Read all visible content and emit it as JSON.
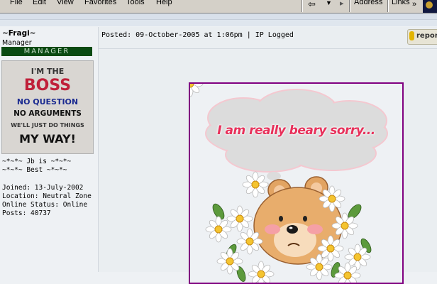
{
  "menu": [
    "File",
    "Edit",
    "View",
    "Favorites",
    "Tools",
    "Help"
  ],
  "toolbar": {
    "address_label": "Address",
    "links_label": "Links"
  },
  "post": {
    "author": {
      "username": "~Fragi~",
      "rank": "Manager",
      "rank_badge": "MANAGER",
      "avatar_text": [
        "I'M THE",
        "BOSS",
        "NO QUESTION",
        "NO ARGUMENTS",
        "WE'LL JUST DO THINGS",
        "MY WAY!"
      ],
      "signature": [
        "~*~*~ Jb is ~*~*~",
        "~*~*~ Best ~*~*~"
      ],
      "joined": "Joined: 13-July-2002",
      "location": "Location: Neutral Zone",
      "status": "Online Status: Online",
      "posts": "Posts: 40737"
    },
    "header": "Posted: 09-October-2005 at 1:06pm | IP Logged",
    "report_label": "report",
    "image_caption": "I am really beary sorry..."
  },
  "colors": {
    "rank_badge_bg": "#0a4a12",
    "image_border": "#800080",
    "caption": "#e8305a"
  }
}
